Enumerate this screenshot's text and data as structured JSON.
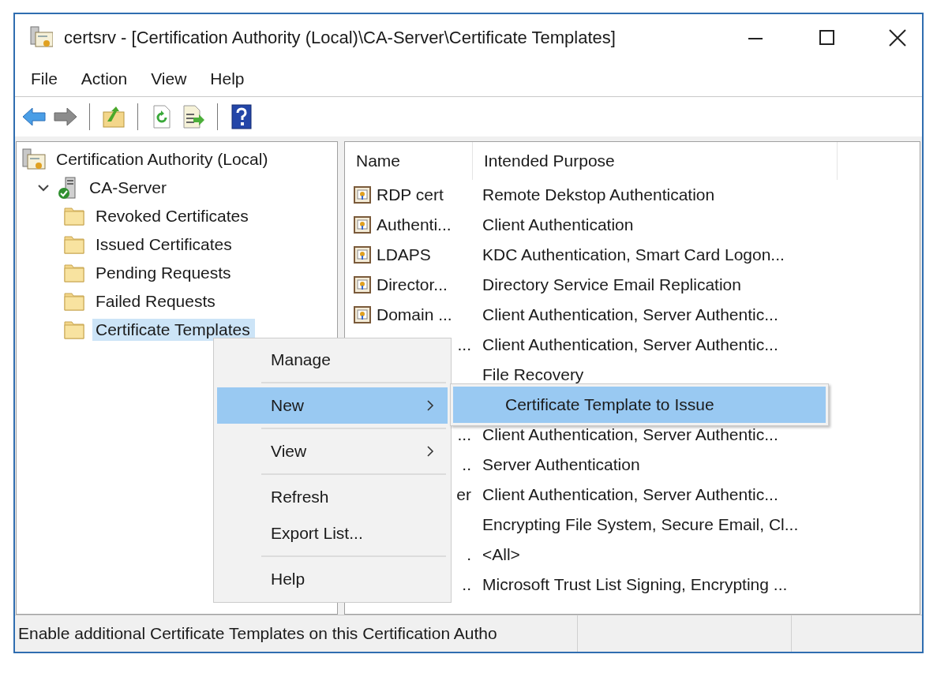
{
  "window": {
    "title": "certsrv - [Certification Authority (Local)\\CA-Server\\Certificate Templates]"
  },
  "menu_bar": [
    "File",
    "Action",
    "View",
    "Help"
  ],
  "toolbar": [
    {
      "kind": "back",
      "disabled": false
    },
    {
      "kind": "forward",
      "disabled": true
    },
    {
      "kind": "separator"
    },
    {
      "kind": "up"
    },
    {
      "kind": "separator"
    },
    {
      "kind": "refresh"
    },
    {
      "kind": "export"
    },
    {
      "kind": "separator"
    },
    {
      "kind": "help"
    }
  ],
  "tree": [
    {
      "label": "Certification Authority (Local)",
      "kind": "authority",
      "selected": false,
      "children": [
        {
          "label": "CA-Server",
          "kind": "server",
          "expanded": true,
          "selected": false,
          "children": [
            {
              "label": "Revoked Certificates",
              "kind": "folder",
              "selected": false
            },
            {
              "label": "Issued Certificates",
              "kind": "folder",
              "selected": false
            },
            {
              "label": "Pending Requests",
              "kind": "folder",
              "selected": false
            },
            {
              "label": "Failed Requests",
              "kind": "folder",
              "selected": false
            },
            {
              "label": "Certificate Templates",
              "kind": "folder",
              "selected": true
            }
          ]
        }
      ]
    }
  ],
  "table": {
    "columns": [
      "Name",
      "Intended Purpose"
    ],
    "rows": [
      {
        "name": "RDP cert",
        "icon": true,
        "clipped": false,
        "purpose": "Remote Dekstop Authentication"
      },
      {
        "name": "Authenti...",
        "icon": true,
        "clipped": false,
        "purpose": "Client Authentication"
      },
      {
        "name": "LDAPS",
        "icon": true,
        "clipped": false,
        "purpose": "KDC Authentication, Smart Card Logon..."
      },
      {
        "name": "Director...",
        "icon": true,
        "clipped": false,
        "purpose": "Directory Service Email Replication"
      },
      {
        "name": "Domain ...",
        "icon": true,
        "clipped": false,
        "purpose": "Client Authentication, Server Authentic..."
      },
      {
        "name": "...",
        "clipped": true,
        "purpose": "Client Authentication, Server Authentic..."
      },
      {
        "purpose": "File Recovery"
      },
      {},
      {
        "name": "...",
        "clipped": true,
        "purpose": "Client Authentication, Server Authentic..."
      },
      {
        "name": "..",
        "clipped": true,
        "purpose": "Server Authentication"
      },
      {
        "name": "er",
        "clipped": true,
        "purpose": "Client Authentication, Server Authentic..."
      },
      {
        "purpose": "Encrypting File System, Secure Email, Cl..."
      },
      {
        "name": ".",
        "clipped": true,
        "purpose": "<All>"
      },
      {
        "name": "..",
        "clipped": true,
        "purpose": "Microsoft Trust List Signing, Encrypting ..."
      }
    ]
  },
  "context_menu": {
    "items": [
      {
        "kind": "item",
        "label": "Manage",
        "selected": false,
        "submenu": false
      },
      {
        "kind": "separator"
      },
      {
        "kind": "item",
        "label": "New",
        "selected": true,
        "submenu": true
      },
      {
        "kind": "separator"
      },
      {
        "kind": "item",
        "label": "View",
        "selected": false,
        "submenu": true
      },
      {
        "kind": "separator"
      },
      {
        "kind": "item",
        "label": "Refresh",
        "selected": false,
        "submenu": false
      },
      {
        "kind": "item",
        "label": "Export List...",
        "selected": false,
        "submenu": false
      },
      {
        "kind": "separator"
      },
      {
        "kind": "item",
        "label": "Help",
        "selected": false,
        "submenu": false
      }
    ]
  },
  "submenu": {
    "items": [
      {
        "label": "Certificate Template to Issue",
        "selected": true
      }
    ]
  },
  "status_bar": {
    "text": "Enable additional Certificate Templates on this Certification Autho"
  }
}
